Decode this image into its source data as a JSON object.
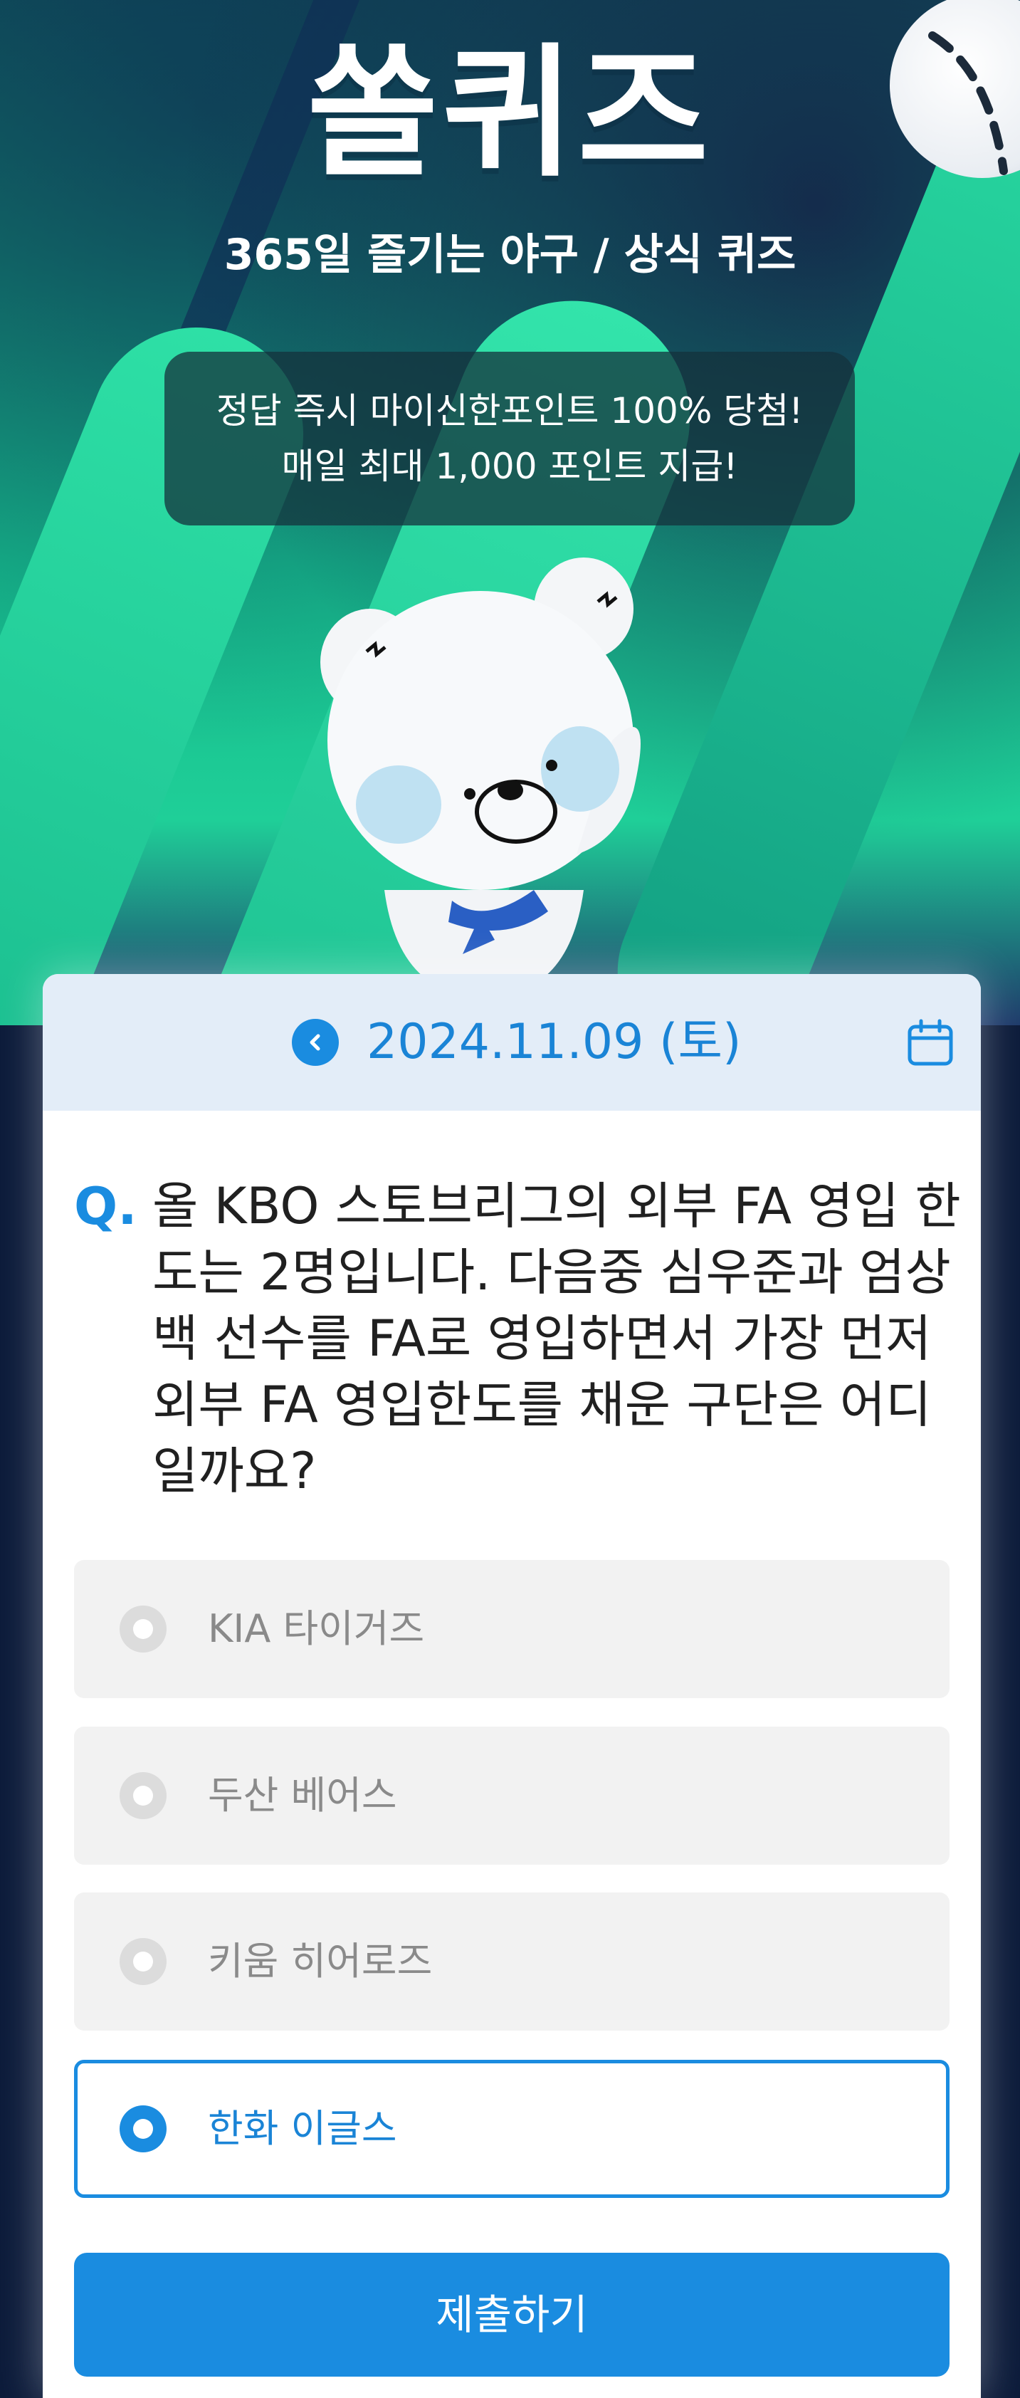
{
  "header": {
    "title": "쏠퀴즈",
    "subtitle": "365일 즐기는 야구 / 상식 퀴즈",
    "promo_line1": "정답 즉시 마이신한포인트 100% 당첨!",
    "promo_line2": "매일 최대 1,000 포인트 지급!"
  },
  "quiz": {
    "date": "2024.11.09 (토)",
    "question_marker": "Q.",
    "question": "올 KBO 스토브리그의 외부 FA 영입 한도는 2명입니다. 다음중 심우준과 엄상백 선수를 FA로 영입하면서 가장 먼저 외부 FA 영입한도를 채운 구단은 어디일까요?",
    "options": [
      {
        "label": "KIA 타이거즈",
        "selected": false
      },
      {
        "label": "두산 베어스",
        "selected": false
      },
      {
        "label": "키움 히어로즈",
        "selected": false
      },
      {
        "label": "한화 이글스",
        "selected": true
      }
    ],
    "submit_label": "제출하기"
  },
  "icons": {
    "prev": "chevron-left-icon",
    "calendar": "calendar-icon"
  },
  "colors": {
    "accent": "#1a8ce0",
    "date_bar": "#e3edf8",
    "option_bg": "#f2f2f2"
  }
}
